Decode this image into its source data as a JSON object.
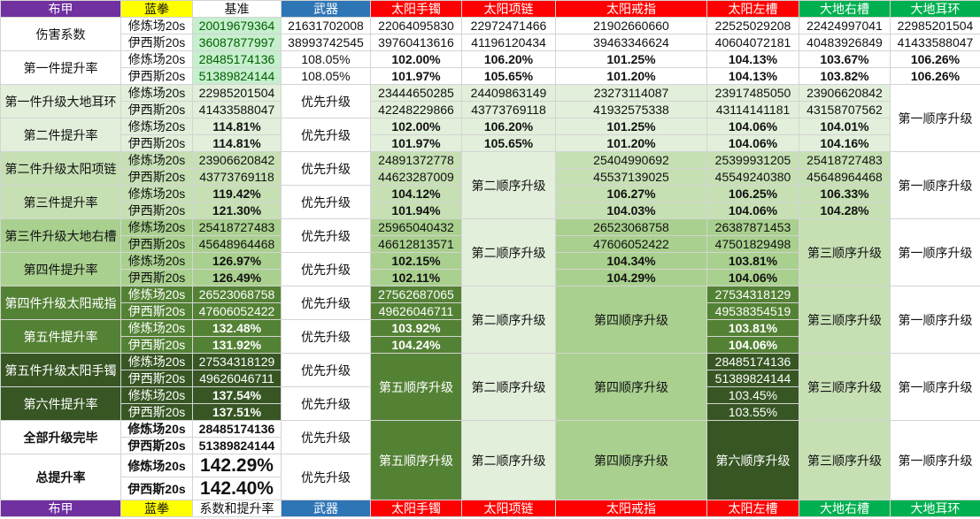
{
  "header": {
    "col0": "布甲",
    "col1": "蓝拳",
    "col2": "基准",
    "col3": "武器",
    "col4": "太阳手镯",
    "col5": "太阳项链",
    "col6": "太阳戒指",
    "col7": "太阳左槽",
    "col8": "大地右槽",
    "col9": "大地耳环"
  },
  "footer": {
    "col0": "布甲",
    "col1": "蓝拳",
    "col2": "系数和提升率",
    "col3": "武器",
    "col4": "太阳手镯",
    "col5": "太阳项链",
    "col6": "太阳戒指",
    "col7": "太阳左槽",
    "col8": "大地右槽",
    "col9": "大地耳环"
  },
  "scenes": {
    "a": "修炼场20s",
    "b": "伊西斯20s"
  },
  "colors": {
    "purple": "#7030a0",
    "yellow": "#ffff00",
    "blue": "#2e75b6",
    "red": "#ff0000",
    "green": "#00b050",
    "tier1": "#e2efda",
    "tier2": "#c6e0b4",
    "tier3": "#a9d08e",
    "tier4": "#548235",
    "tier5": "#375623"
  },
  "damage": {
    "label": "伤害系数",
    "a": [
      "20019679364",
      "21631702008",
      "22064095830",
      "22972471466",
      "21902660660",
      "22525029208",
      "22424997041",
      "22985201504"
    ],
    "b": [
      "36087877997",
      "38993742545",
      "39760413616",
      "41196120434",
      "39463346624",
      "40604072181",
      "40483926849",
      "41433588047"
    ]
  },
  "first": {
    "label": "第一件提升率",
    "base_a": "28485174136",
    "base_b": "51389824144",
    "a": [
      "108.05%",
      "102.00%",
      "106.20%",
      "101.25%",
      "104.13%",
      "103.67%",
      "106.26%"
    ],
    "b": [
      "108.05%",
      "101.97%",
      "105.65%",
      "101.20%",
      "104.13%",
      "103.82%",
      "106.26%"
    ]
  },
  "priority": "优先升级",
  "s1": {
    "label": "第一件升级大地耳环",
    "rate_label": "第二件提升率",
    "base_a": "22985201504",
    "base_b": "41433588047",
    "rate_a": "114.81%",
    "rate_b": "114.81%",
    "sol": {
      "a": "23444650285",
      "b": "42248229866",
      "ra": "102.00%",
      "rb": "101.97%"
    },
    "neck": {
      "a": "24409863149",
      "b": "43773769118",
      "ra": "106.20%",
      "rb": "105.65%"
    },
    "ring": {
      "a": "23273114087",
      "b": "41932575338",
      "ra": "101.25%",
      "rb": "101.20%"
    },
    "left": {
      "a": "23917485050",
      "b": "43114141181",
      "ra": "104.06%",
      "rb": "104.06%"
    },
    "right": {
      "a": "23906620842",
      "b": "43158707562",
      "ra": "104.01%",
      "rb": "104.16%"
    },
    "ear": "第一顺序升级"
  },
  "s2": {
    "label": "第二件升级太阳项链",
    "rate_label": "第三件提升率",
    "base_a": "23906620842",
    "base_b": "43773769118",
    "rate_a": "119.42%",
    "rate_b": "121.30%",
    "sol": {
      "a": "24891372778",
      "b": "44623287009",
      "ra": "104.12%",
      "rb": "101.94%"
    },
    "neck": "第二顺序升级",
    "ring": {
      "a": "25404990692",
      "b": "45537139025",
      "ra": "106.27%",
      "rb": "104.03%"
    },
    "left": {
      "a": "25399931205",
      "b": "45549240380",
      "ra": "106.25%",
      "rb": "104.06%"
    },
    "right": {
      "a": "25418727483",
      "b": "45648964468",
      "ra": "106.33%",
      "rb": "104.28%"
    },
    "ear": "第一顺序升级"
  },
  "s3": {
    "label": "第三件升级大地右槽",
    "rate_label": "第四件提升率",
    "base_a": "25418727483",
    "base_b": "45648964468",
    "rate_a": "126.97%",
    "rate_b": "126.49%",
    "sol": {
      "a": "25965040432",
      "b": "46612813571",
      "ra": "102.15%",
      "rb": "102.11%"
    },
    "neck": "第二顺序升级",
    "ring": {
      "a": "26523068758",
      "b": "47606052422",
      "ra": "104.34%",
      "rb": "104.29%"
    },
    "left": {
      "a": "26387871453",
      "b": "47501829498",
      "ra": "103.81%",
      "rb": "104.06%"
    },
    "right": "第三顺序升级",
    "ear": "第一顺序升级"
  },
  "s4": {
    "label": "第四件升级太阳戒指",
    "rate_label": "第五件提升率",
    "base_a": "26523068758",
    "base_b": "47606052422",
    "rate_a": "132.48%",
    "rate_b": "131.92%",
    "sol": {
      "a": "27562687065",
      "b": "49626046711",
      "ra": "103.92%",
      "rb": "104.24%"
    },
    "neck": "第二顺序升级",
    "ring": "第四顺序升级",
    "left": {
      "a": "27534318129",
      "b": "49538354519",
      "ra": "103.81%",
      "rb": "104.06%"
    },
    "right": "第三顺序升级",
    "ear": "第一顺序升级"
  },
  "s5": {
    "label": "第五件升级太阳手镯",
    "rate_label": "第六件提升率",
    "base_a": "27534318129",
    "base_b": "49626046711",
    "rate_a": "137.54%",
    "rate_b": "137.51%",
    "sol": "第五顺序升级",
    "neck": "第二顺序升级",
    "ring": "第四顺序升级",
    "left": {
      "a": "28485174136",
      "b": "51389824144",
      "ra": "103.45%",
      "rb": "103.55%"
    },
    "right": "第三顺序升级",
    "ear": "第一顺序升级"
  },
  "done": {
    "label": "全部升级完毕",
    "a": "28485174136",
    "b": "51389824144"
  },
  "total": {
    "label": "总提升率",
    "a": "142.29%",
    "b": "142.40%",
    "sol": "第五顺序升级",
    "neck": "第二顺序升级",
    "ring": "第四顺序升级",
    "left": "第六顺序升级",
    "right": "第三顺序升级",
    "ear": "第一顺序升级"
  }
}
